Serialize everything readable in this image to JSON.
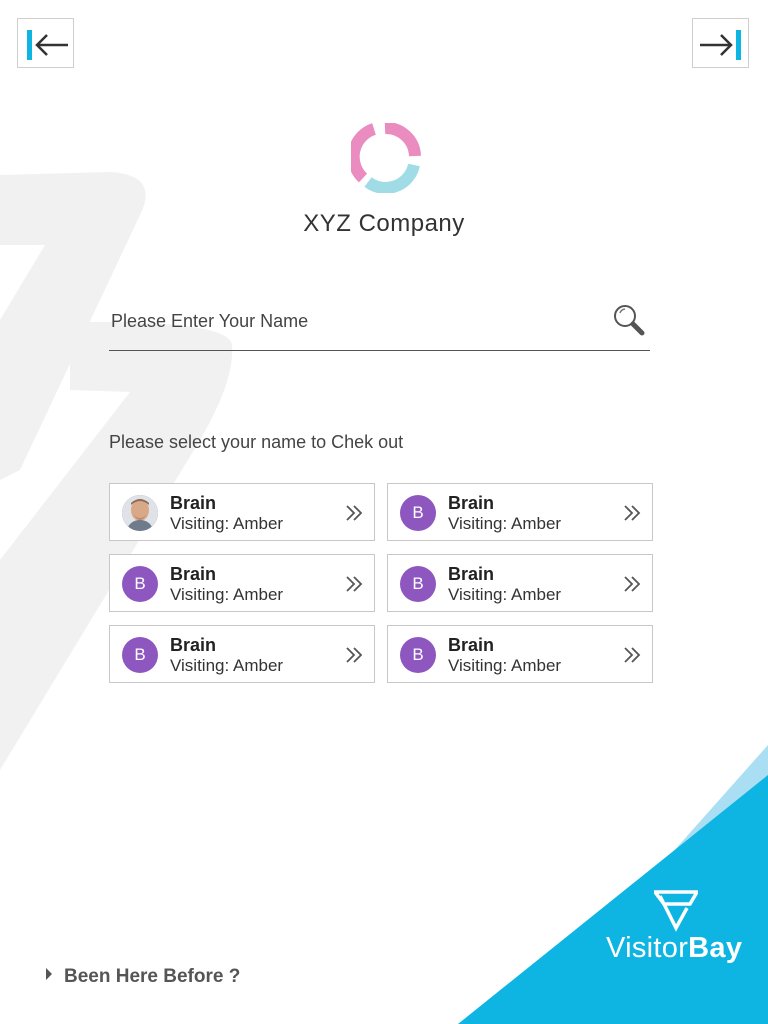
{
  "colors": {
    "accent": "#0eb5e3",
    "avatar": "#8e57c0",
    "logo_pink": "#ea8cc0",
    "logo_cyan": "#a0dce5"
  },
  "company": {
    "name": "XYZ Company"
  },
  "search": {
    "placeholder": "Please Enter Your Name"
  },
  "list": {
    "label": "Please select your name to Chek out",
    "entries": [
      {
        "name": "Brain",
        "visiting": "Visiting: Amber",
        "avatar_initial": "",
        "has_photo": true
      },
      {
        "name": "Brain",
        "visiting": "Visiting: Amber",
        "avatar_initial": "B",
        "has_photo": false
      },
      {
        "name": "Brain",
        "visiting": "Visiting: Amber",
        "avatar_initial": "B",
        "has_photo": false
      },
      {
        "name": "Brain",
        "visiting": "Visiting: Amber",
        "avatar_initial": "B",
        "has_photo": false
      },
      {
        "name": "Brain",
        "visiting": "Visiting: Amber",
        "avatar_initial": "B",
        "has_photo": false
      },
      {
        "name": "Brain",
        "visiting": "Visiting: Amber",
        "avatar_initial": "B",
        "has_photo": false
      }
    ]
  },
  "footer": {
    "been_here": "Been Here Before ?"
  },
  "brand": {
    "visitor": "Visitor",
    "bay": "Bay"
  },
  "icons": {
    "prev": "arrow-left-to-line-icon",
    "next": "arrow-right-to-line-icon",
    "search": "search-icon",
    "chevron": "double-chevron-right-icon"
  }
}
